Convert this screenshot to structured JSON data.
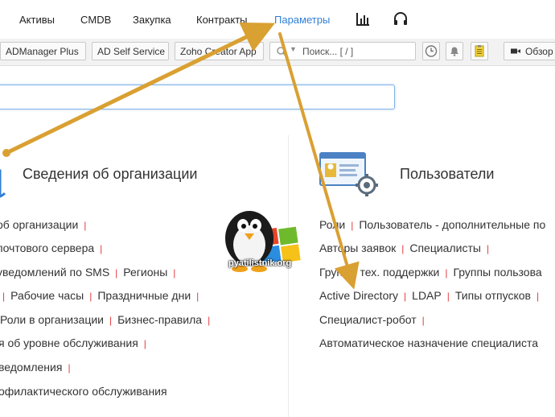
{
  "nav": {
    "items": [
      "Активы",
      "CMDB",
      "Закупка",
      "Контракты",
      "Параметры"
    ],
    "active_index": 4,
    "reports_icon": "bar-chart-icon",
    "support_icon": "headset-icon"
  },
  "toolbar": {
    "buttons": [
      "ADManager Plus",
      "AD Self Service",
      "Zoho Creator App"
    ],
    "search_placeholder": "Поиск... [ / ]",
    "overview_label": "Обзор"
  },
  "filter_input": {
    "value": "",
    "placeholder": ""
  },
  "left_section": {
    "title": "Сведения об организации",
    "rows": [
      [
        "об организации"
      ],
      [
        "почтового сервера"
      ],
      [
        "уведомлений по SMS",
        "Регионы"
      ],
      [
        "",
        "Рабочие часы",
        "Праздничные дни"
      ],
      [
        "Роли в организации",
        "Бизнес-правила"
      ],
      [
        "я об уровне обслуживания"
      ],
      [
        "ведомления"
      ],
      [
        "офилактического обслуживания"
      ]
    ]
  },
  "right_section": {
    "title": "Пользователи",
    "rows": [
      [
        "Роли",
        "Пользователь - дополнительные по"
      ],
      [
        "Авторы заявок",
        "Специалисты"
      ],
      [
        "Группы тех. поддержки",
        "Группы пользова"
      ],
      [
        "Active Directory",
        "LDAP",
        "Типы отпусков"
      ],
      [
        "Специалист-робот"
      ],
      [
        "Автоматическое назначение специалиста"
      ]
    ]
  },
  "watermark": {
    "text": "pyatilistnik.org"
  },
  "colors": {
    "accent": "#2f7fd6",
    "separator": "#e23b3b",
    "annotation_arrow": "#d9a032"
  }
}
